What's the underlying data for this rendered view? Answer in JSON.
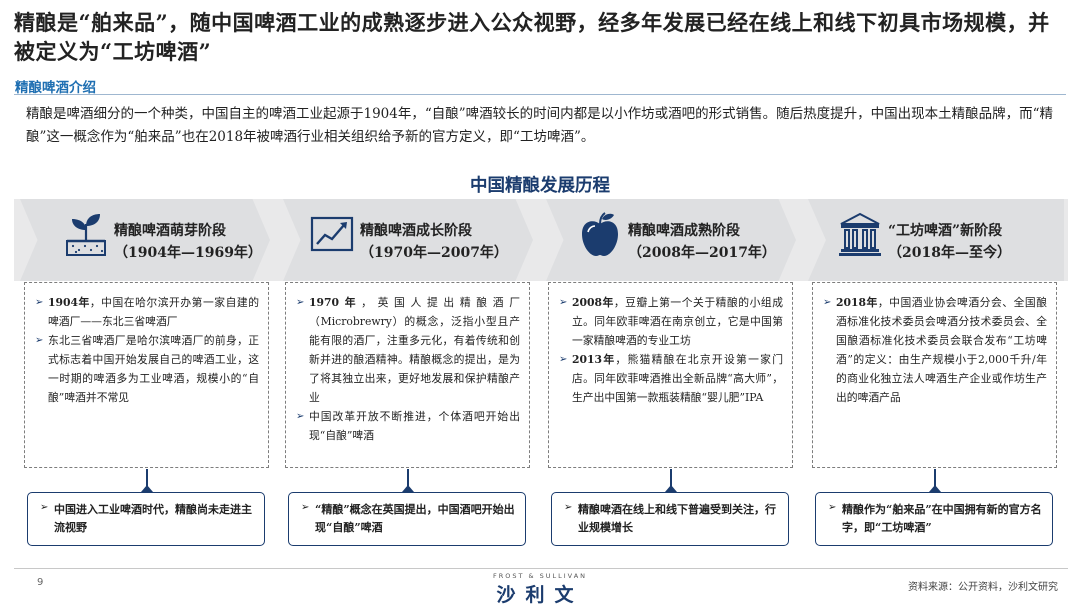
{
  "header": {
    "title": "精酿是“舶来品”，随中国啤酒工业的成熟逐步进入公众视野，经多年发展已经在线上和线下初具市场规模，并被定义为“工坊啤酒”",
    "subtitle": "精酿啤酒介绍",
    "intro": "精酿是啤酒细分的一个种类，中国自主的啤酒工业起源于1904年，“自酿”啤酒较长的时间内都是以小作坊或酒吧的形式销售。随后热度提升，中国出现本土精酿品牌，而“精酿”这一概念作为“舶来品”也在2018年被啤酒行业相关组织给予新的官方定义，即“工坊啤酒”。"
  },
  "section_title": "中国精酿发展历程",
  "bullet_symbol": "➢",
  "phases": [
    {
      "icon": "sprout-icon",
      "name": "精酿啤酒萌芽阶段",
      "years": "（1904年—1969年）",
      "items": [
        {
          "bold": "1904年",
          "text": "，中国在哈尔滨开办第一家自建的啤酒厂——东北三省啤酒厂"
        },
        {
          "bold": "",
          "text": "东北三省啤酒厂是哈尔滨啤酒厂的前身，正式标志着中国开始发展自己的啤酒工业，这一时期的啤酒多为工业啤酒，规模小的“自酿”啤酒并不常见"
        }
      ],
      "summary": "中国进入工业啤酒时代，精酿尚未走进主流视野"
    },
    {
      "icon": "growth-chart-icon",
      "name": "精酿啤酒成长阶段",
      "years": "（1970年—2007年）",
      "items": [
        {
          "bold": "1970年",
          "text": "，英国人提出精酿酒厂（Microbrewry）的概念，泛指小型且产能有限的酒厂，注重多元化，有着传统和创新并进的酿酒精神。精酿概念的提出，是为了将其独立出来，更好地发展和保护精酿产业"
        },
        {
          "bold": "",
          "text": "中国改革开放不断推进，个体酒吧开始出现“自酿”啤酒"
        }
      ],
      "summary": "“精酿”概念在英国提出，中国酒吧开始出现“自酿”啤酒"
    },
    {
      "icon": "apple-icon",
      "name": "精酿啤酒成熟阶段",
      "years": "（2008年—2017年）",
      "items": [
        {
          "bold": "2008年",
          "text": "，豆瓣上第一个关于精酿的小组成立。同年欧菲啤酒在南京创立，它是中国第一家精酿啤酒的专业工坊"
        },
        {
          "bold": "2013年",
          "text": "，熊猫精酿在北京开设第一家门店。同年欧菲啤酒推出全新品牌“高大师”，生产出中国第一款瓶装精酿“婴儿肥”IPA"
        }
      ],
      "summary": "精酿啤酒在线上和线下普遍受到关注，行业规模增长"
    },
    {
      "icon": "institution-icon",
      "name": "“工坊啤酒”新阶段",
      "years": "（2018年—至今）",
      "items": [
        {
          "bold": "2018年",
          "text": "，中国酒业协会啤酒分会、全国酿酒标准化技术委员会啤酒分技术委员会、全国酿酒标准化技术委员会联合发布“工坊啤酒”的定义：由生产规模小于2,000千升/年的商业化独立法人啤酒生产企业或作坊生产出的啤酒产品"
        }
      ],
      "summary": "精酿作为“舶来品”在中国拥有新的官方名字，即“工坊啤酒”"
    }
  ],
  "footer": {
    "page_number": "9",
    "logo_small": "FROST & SULLIVAN",
    "logo": "沙利文",
    "source": "资料来源：公开资料，沙利文研究"
  },
  "colors": {
    "accent": "#1f6fb2",
    "navy": "#1b3c6e",
    "band": "#e9e9ea"
  }
}
